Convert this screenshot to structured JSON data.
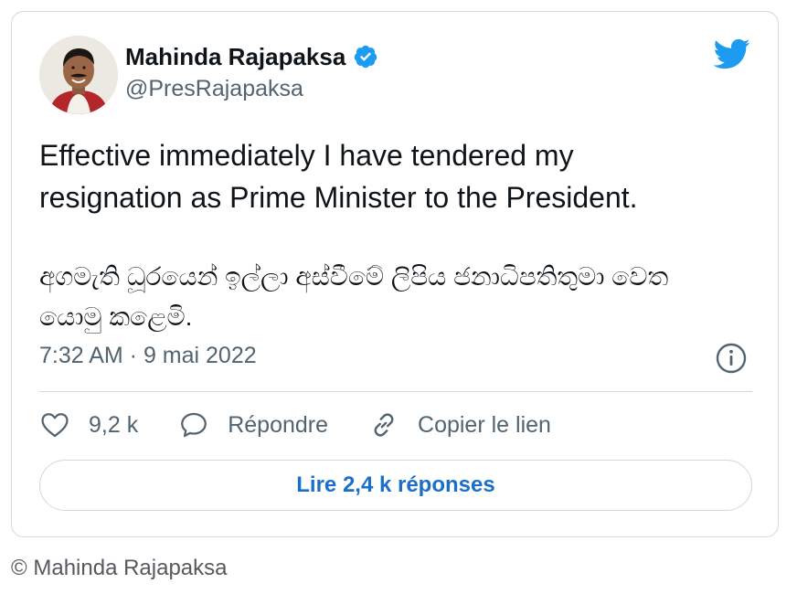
{
  "author": {
    "name": "Mahinda Rajapaksa",
    "handle": "@PresRajapaksa",
    "verified": true
  },
  "tweet": {
    "text_en": "Effective immediately I have tendered my\nresignation as Prime Minister to the President.",
    "text_si": "අගමැති ධූරයෙන් ඉල්ලා අස්වීමේ ලිපිය ජනාධිපතිතුමා වෙත\nයොමු කළෙමි.",
    "timestamp": "7:32 AM · 9 mai 2022"
  },
  "actions": {
    "likes": "9,2 k",
    "reply": "Répondre",
    "copy_link": "Copier le lien"
  },
  "read_replies": "Lire 2,4 k réponses",
  "copyright": "© Mahinda Rajapaksa",
  "colors": {
    "twitter_blue": "#1d9bf0",
    "link_blue": "#1b6fc8",
    "secondary_text": "#536471",
    "border": "#cfd9de"
  },
  "icons": [
    "verified-badge-icon",
    "twitter-bird-icon",
    "info-icon",
    "heart-icon",
    "reply-bubble-icon",
    "link-icon"
  ]
}
